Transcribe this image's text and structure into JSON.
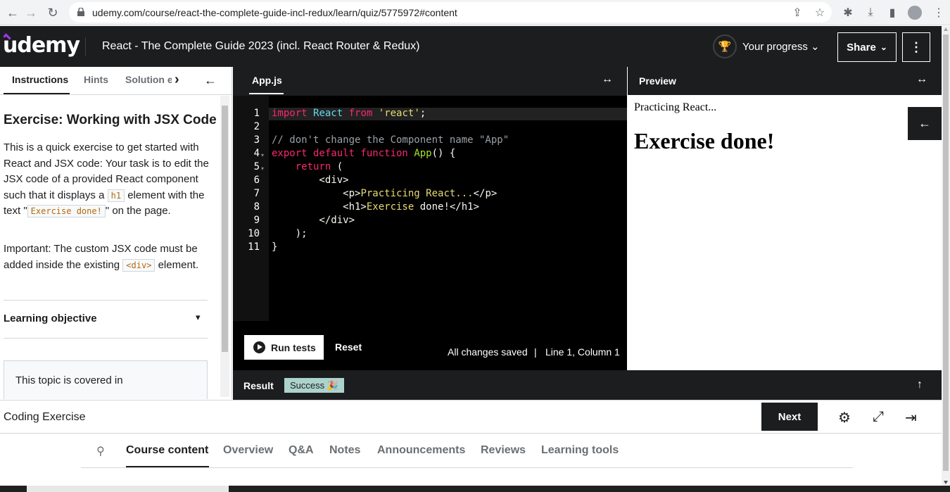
{
  "browser": {
    "url": "udemy.com/course/react-the-complete-guide-incl-redux/learn/quiz/5775972#content"
  },
  "header": {
    "logo": "udemy",
    "course_title": "React - The Complete Guide 2023 (incl. React Router & Redux)",
    "progress_label": "Your progress",
    "share_label": "Share"
  },
  "left_panel": {
    "tabs": [
      "Instructions",
      "Hints",
      "Solution e"
    ],
    "title": "Exercise: Working with JSX Code",
    "para1_a": "This is a quick exercise to get started with React and JSX code: Your task is to edit the JSX code of a provided React component such that it displays a",
    "para1_code1": "h1",
    "para1_b": "element with the text \"",
    "para1_code2": "Exercise done!",
    "para1_c": "\" on the page.",
    "para2_a": "Important: The custom JSX code must be added inside the existing",
    "para2_code": "<div>",
    "para2_b": "element.",
    "learning_objective": "Learning objective",
    "topic_text": "This topic is covered in"
  },
  "editor": {
    "file_tab": "App.js",
    "line_numbers": [
      "1",
      "2",
      "3",
      "4",
      "5",
      "6",
      "7",
      "8",
      "9",
      "10",
      "11"
    ],
    "run_label": "Run tests",
    "reset_label": "Reset",
    "saved_status": "All changes saved",
    "separator": "|",
    "cursor_position": "Line 1, Column 1"
  },
  "preview": {
    "title": "Preview",
    "paragraph": "Practicing React...",
    "heading": "Exercise done!"
  },
  "result": {
    "label": "Result",
    "badge": "Success 🎉"
  },
  "footer": {
    "label": "Coding Exercise",
    "next_label": "Next"
  },
  "course_tabs": [
    "Course content",
    "Overview",
    "Q&A",
    "Notes",
    "Announcements",
    "Reviews",
    "Learning tools"
  ],
  "colors": {
    "header_bg": "#1c1d1f",
    "accent": "#a435f0",
    "success_badge": "#acd2cc",
    "code_bg": "#000000"
  }
}
